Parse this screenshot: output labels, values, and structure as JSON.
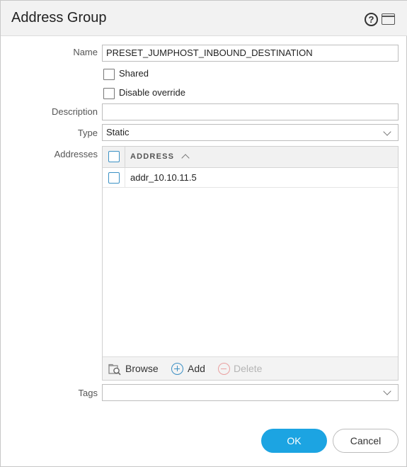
{
  "dialog": {
    "title": "Address Group",
    "help_icon_glyph": "?",
    "icons": {
      "help": "help-circle-icon",
      "maximize": "maximize-icon"
    }
  },
  "form": {
    "name_label": "Name",
    "name_value": "PRESET_JUMPHOST_INBOUND_DESTINATION",
    "shared_label": "Shared",
    "shared_checked": false,
    "disable_override_label": "Disable override",
    "disable_override_checked": false,
    "description_label": "Description",
    "description_value": "",
    "type_label": "Type",
    "type_value": "Static",
    "addresses_label": "Addresses",
    "tags_label": "Tags",
    "tags_value": ""
  },
  "addresses_grid": {
    "column_header": "ADDRESS",
    "sort": "ascending",
    "rows": [
      {
        "address": "addr_10.10.11.5",
        "checked": false
      }
    ],
    "footer": {
      "browse_label": "Browse",
      "add_label": "Add",
      "delete_label": "Delete",
      "delete_enabled": false
    }
  },
  "buttons": {
    "ok_label": "OK",
    "cancel_label": "Cancel"
  },
  "colors": {
    "accent": "#1ca4e2",
    "checkbox_blue": "#3b91c5",
    "delete_disabled": "#eaa0a0"
  }
}
